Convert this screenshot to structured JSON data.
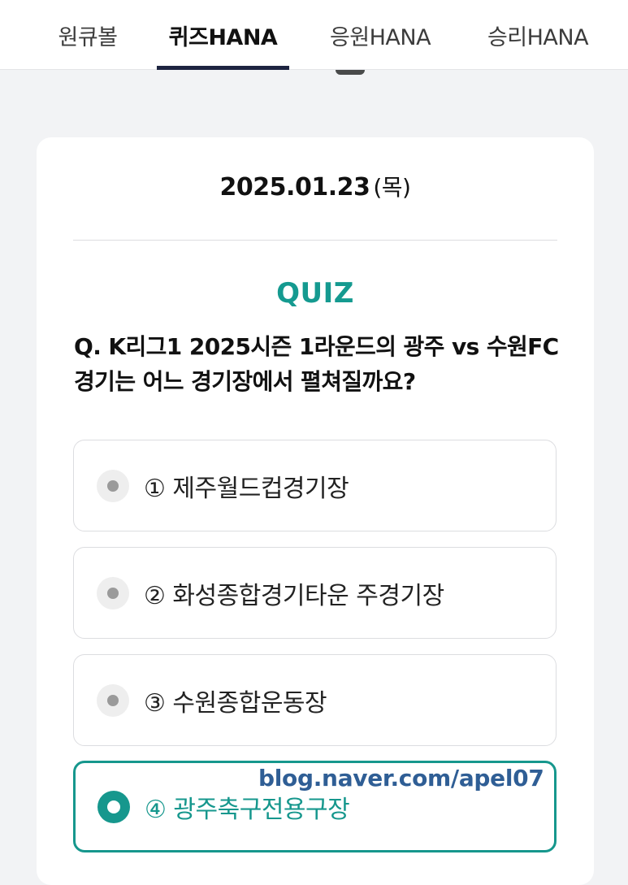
{
  "tabs": [
    {
      "label": "원큐볼",
      "active": false
    },
    {
      "label": "퀴즈HANA",
      "active": true
    },
    {
      "label": "응원HANA",
      "active": false
    },
    {
      "label": "승리HANA",
      "active": false
    }
  ],
  "card": {
    "date": "2025.01.23",
    "day_of_week": "(목)",
    "quiz_label": "QUIZ",
    "question": "Q. K리그1 2025시즌 1라운드의 광주 vs 수원FC 경기는 어느 경기장에서 펼쳐질까요?",
    "options": [
      {
        "label": "① 제주월드컵경기장",
        "selected": false
      },
      {
        "label": "② 화성종합경기타운 주경기장",
        "selected": false
      },
      {
        "label": "③ 수원종합운동장",
        "selected": false
      },
      {
        "label": "④ 광주축구전용구장",
        "selected": true
      }
    ]
  },
  "watermark": "blog.naver.com/apel07",
  "colors": {
    "accent": "#16978d",
    "tab_indicator": "#1d2440",
    "watermark": "#2f5e95",
    "background": "#f2f3f5"
  }
}
